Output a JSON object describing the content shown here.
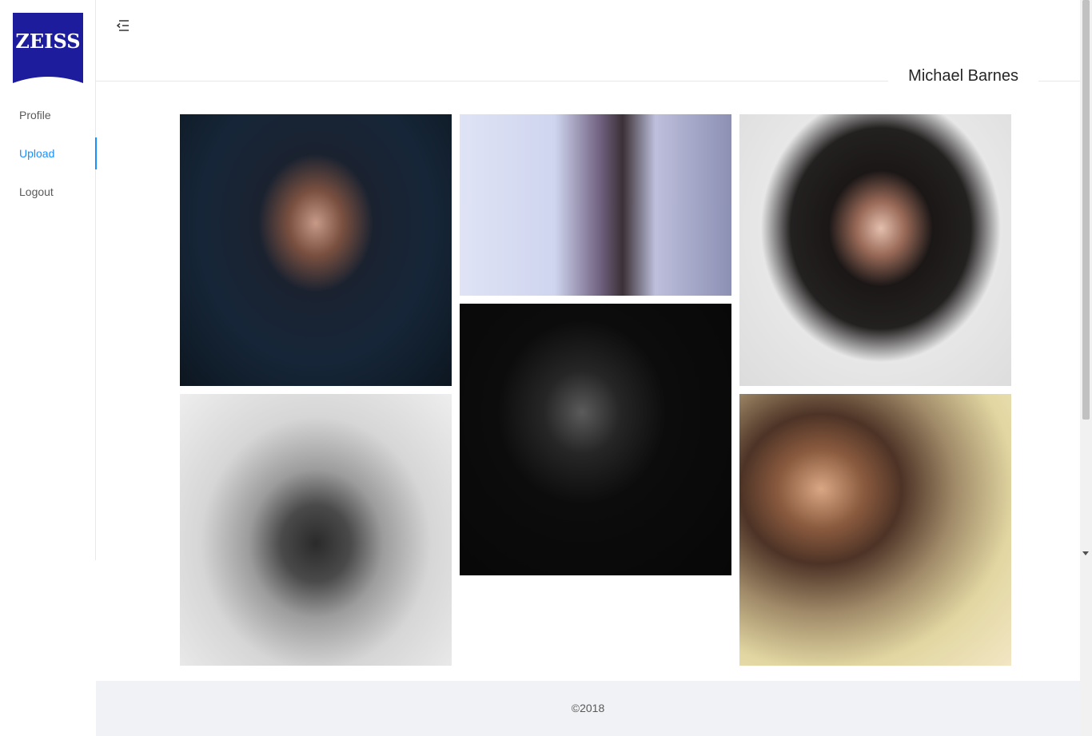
{
  "brand": {
    "logo_text": "ZEISS",
    "color": "#1c1c9c"
  },
  "accent_color": "#1890ff",
  "sidebar": {
    "items": [
      {
        "label": "Profile",
        "active": false
      },
      {
        "label": "Upload",
        "active": true
      },
      {
        "label": "Logout",
        "active": false
      }
    ]
  },
  "header": {
    "menu_icon": "menu-fold-icon",
    "user_name": "Michael Barnes"
  },
  "gallery": {
    "photos": [
      {
        "name": "photo-portrait-woman-dark-hair"
      },
      {
        "name": "photo-woman-by-window"
      },
      {
        "name": "photo-woman-laughing-hand-face"
      },
      {
        "name": "photo-man-with-twin-lens-camera"
      },
      {
        "name": "photo-woman-silhouette-dark"
      },
      {
        "name": "photo-woman-in-store"
      }
    ]
  },
  "footer": {
    "copyright": "©2018"
  }
}
